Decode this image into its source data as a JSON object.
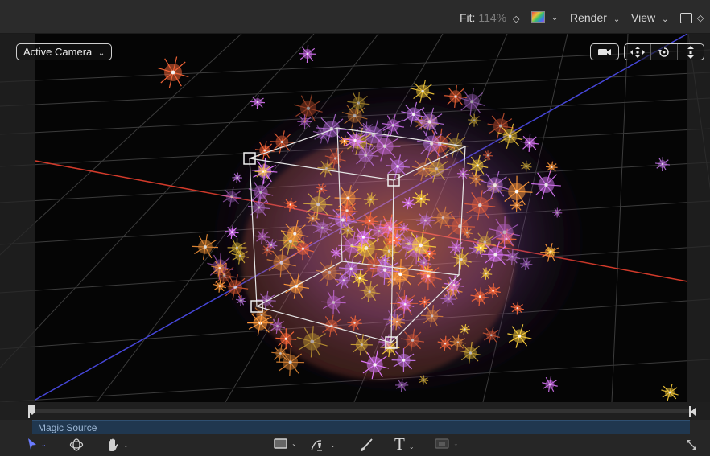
{
  "toolbar": {
    "fit_label": "Fit:",
    "fit_value": "114%",
    "render_label": "Render",
    "view_label": "View",
    "chevron_glyph": "⌄",
    "stepper_glyph": "◇"
  },
  "canvas": {
    "camera_menu": "Active Camera",
    "camera_chevron": "⌄",
    "axes": {
      "x_color": "#d23a2a",
      "z_color": "#4646d8"
    }
  },
  "timeline": {
    "layer_name": "Magic Source"
  },
  "tools": {
    "text_tool": "T"
  },
  "colors": {
    "accent": "#6a7bff",
    "panel": "#2b2b2b",
    "viewer_bg": "#050505",
    "layer_bar": "#20374f",
    "particles": [
      "#ff6a3a",
      "#c87af0",
      "#ffd23c",
      "#ff9a3c",
      "#e07aff"
    ]
  }
}
